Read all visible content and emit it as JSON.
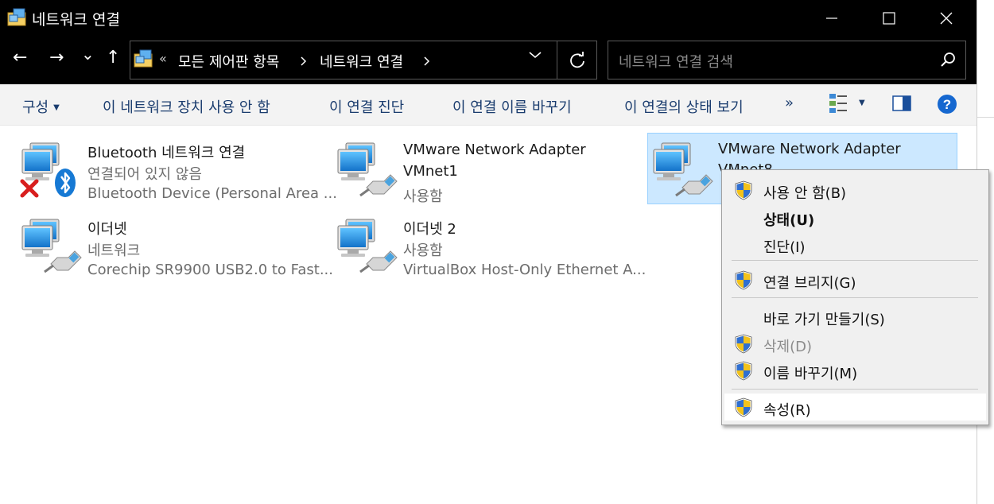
{
  "window": {
    "title": "네트워크 연결",
    "controls": {
      "minimize": "minimize-icon",
      "maximize": "maximize-icon",
      "close": "close-icon"
    }
  },
  "nav": {
    "back": "←",
    "forward": "→",
    "recent": "⌄",
    "up": "↑",
    "overflow": "«",
    "breadcrumb": [
      "모든 제어판 항목",
      "네트워크 연결"
    ],
    "search_placeholder": "네트워크 연결 검색"
  },
  "toolbar": {
    "organize": "구성",
    "disable": "이 네트워크 장치 사용 안 함",
    "diagnose": "이 연결 진단",
    "rename": "이 연결 이름 바꾸기",
    "status": "이 연결의 상태 보기",
    "more": "»"
  },
  "connections": [
    {
      "name": "Bluetooth 네트워크 연결",
      "status": "연결되어 있지 않음",
      "device": "Bluetooth Device (Personal Area ..."
    },
    {
      "name": "VMware Network Adapter",
      "status": "VMnet1",
      "device": "사용함"
    },
    {
      "name": "VMware Network Adapter",
      "status": "VMnet8",
      "device": ""
    },
    {
      "name": "이더넷",
      "status": "네트워크",
      "device": "Corechip SR9900 USB2.0 to Fast..."
    },
    {
      "name": "이더넷 2",
      "status": "사용함",
      "device": "VirtualBox Host-Only Ethernet A..."
    }
  ],
  "context_menu": [
    {
      "label": "사용 안 함(B)",
      "shield": true
    },
    {
      "label": "상태(U)",
      "bold": true
    },
    {
      "label": "진단(I)"
    },
    {
      "label": "연결 브리지(G)",
      "shield": true
    },
    {
      "label": "바로 가기 만들기(S)"
    },
    {
      "label": "삭제(D)",
      "shield": true,
      "disabled": true
    },
    {
      "label": "이름 바꾸기(M)",
      "shield": true
    },
    {
      "label": "속성(R)",
      "shield": true,
      "highlighted": true
    }
  ],
  "colors": {
    "titlebar": "#000000",
    "command_text": "#1a3c6e",
    "selection": "#cce8ff",
    "menu_bg": "#f0f0f0"
  }
}
